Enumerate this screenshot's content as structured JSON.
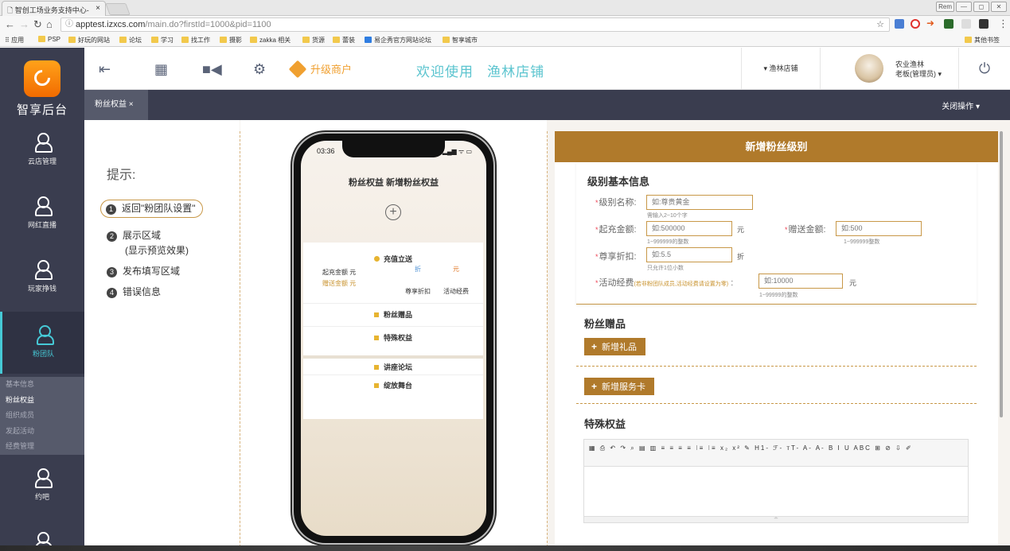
{
  "browser": {
    "tab_title": "智创工场业务支持中心-",
    "tab_close": "×",
    "win_btns": [
      "Rem",
      "—",
      "◻",
      "✕"
    ],
    "url_host": "apptest.izxcs.com",
    "url_path": "/main.do?firstId=1000&pid=1100",
    "bookmarks": [
      "应用",
      "PSP",
      "好玩的网站",
      "论坛",
      "学习",
      "找工作",
      "摄影",
      "zakka 相关",
      "货源",
      "蕾装",
      "易企秀官方网站论坛",
      "智享城市"
    ],
    "bookmarks_other": "其他书签"
  },
  "app": {
    "brand": "智享后台",
    "upgrade_label": "升级商户",
    "welcome_text": "欢迎使用",
    "shop_text": "渔林店铺",
    "shop_select": "▾ 渔林店铺",
    "user_name": "农业渔林",
    "user_role": "老板(管理员) ▾",
    "nav": [
      {
        "label": "云店管理"
      },
      {
        "label": "网红直播"
      },
      {
        "label": "玩家挣钱"
      },
      {
        "label": "粉团队"
      },
      {
        "label": "约吧"
      }
    ],
    "submenu": [
      "基本信息",
      "粉丝权益",
      "组织成员",
      "发起活动",
      "经费管理"
    ],
    "open_tab": "粉丝权益 ×",
    "close_ops": "关闭操作 ▾"
  },
  "tips": {
    "title": "提示:",
    "items": [
      {
        "num": "1",
        "text": "返回\"粉团队设置\""
      },
      {
        "num": "2",
        "text": "展示区域"
      },
      {
        "num": "",
        "text": "(显示预览效果)"
      },
      {
        "num": "3",
        "text": "发布填写区域"
      },
      {
        "num": "4",
        "text": "错误信息"
      }
    ]
  },
  "phone": {
    "time": "03:36",
    "signal": "▂▄▆ ᯤ ▭",
    "title": "粉丝权益 新增粉丝权益",
    "plus": "+",
    "sections": {
      "recharge": "充值立送",
      "gifts": "粉丝赠品",
      "special": "特殊权益",
      "forum": "讲座论坛",
      "stage": "绽放舞台"
    },
    "recharge_amount": "起充金额 元",
    "gift_amount": "赠送金额 元",
    "discount_icon": "折",
    "discount_label": "尊享折扣",
    "fee_icon": "元",
    "fee_label": "活动经费"
  },
  "form": {
    "header": "新增粉丝级别",
    "basic_title": "级别基本信息",
    "level_name": {
      "label": "级别名称:",
      "placeholder": "如:尊贵黄金",
      "hint": "需输入2~10个字"
    },
    "start_amount": {
      "label": "起充金额:",
      "placeholder": "如:500000",
      "hint": "1~999999的整数",
      "unit": "元"
    },
    "gift_amount": {
      "label": "赠送金额:",
      "placeholder": "如:500",
      "hint": "1~999999整数"
    },
    "discount": {
      "label": "尊享折扣:",
      "placeholder": "如:5.5",
      "hint": "只允许1位小数",
      "unit": "折"
    },
    "activity_fee": {
      "label": "活动经费",
      "note": "(若非粉团队成员,活动经费请设置为零)",
      "colon": ":",
      "placeholder": "如:10000",
      "hint": "1~99999的整数",
      "unit": "元"
    },
    "gifts_title": "粉丝赠品",
    "add_gift": "新增礼品",
    "add_card": "新增服务卡",
    "special_title": "特殊权益",
    "toolbar": "▦ ⎙ ↶ ↷ ⌕ ▤ ▥ ≡ ≡ ≡ ≡ ⁝≡ ⁝≡ x₂ x² ✎ H1- ℱ- тT- A- A- B I U ABC ⊞ ⊘ ⇩ ✐",
    "resize": "∸"
  }
}
